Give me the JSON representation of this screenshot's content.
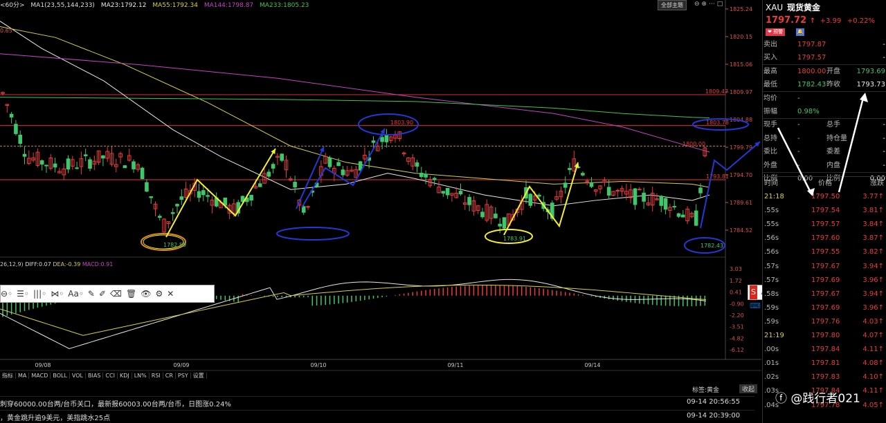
{
  "topbar": {
    "period": "<60分>",
    "ma1": "MA1(23,55,144,233)",
    "ma23": "MA23:1792.12",
    "ma55": "MA55:1792.34",
    "ma144": "MA144:1798.87",
    "ma233": "MA233:1805.23",
    "theme_btn": "全部主题",
    "left_edge_value": "0.65"
  },
  "price_axis": [
    "1825.24",
    "1820.15",
    "1815.06",
    "1809.97",
    "1804.88",
    "1799.79",
    "1794.70",
    "1789.61",
    "1784.52"
  ],
  "macd_axis": [
    "3.03",
    "1.72",
    "0.41",
    "-0.90",
    "-2.20",
    "-3.51",
    "-4.82",
    "-6.12"
  ],
  "macd_header": {
    "params": "26,12,9)",
    "diff": "DIFF:0.07",
    "dea": "DEA:-0.39",
    "macd": "MACD:0.91"
  },
  "date_axis": [
    "09/08",
    "09/09",
    "09/10",
    "09/11",
    "09/14"
  ],
  "annotations": {
    "low1": "1782.59",
    "high1": "1803.90",
    "low2": "1783.91",
    "low3": "1782.43",
    "hl1": "1809.47",
    "hl2": "1803.78",
    "hl3": "1800.00",
    "hl4": "1793.81"
  },
  "drawing_toolbar": {
    "items": [
      "⊖◦",
      "☰◦",
      "|||◦",
      "⋈◦",
      "Aa◦",
      "✎",
      "✐",
      "⌫",
      "🗑",
      "👁",
      "⚙",
      "✕"
    ]
  },
  "indicator_tabs": [
    "指标",
    "MA",
    "MACD",
    "BOLL",
    "VOL",
    "BIAS",
    "CCI",
    "KDJ",
    "LN%",
    "RSI",
    "CR",
    "PSY",
    "设置"
  ],
  "bottom": {
    "tag": "标签:黄金",
    "collapse": "收起",
    "news": [
      {
        "text": "刺穿60000.00台两/台币关口，最新报60003.00台两/台币，日图涨0.24%",
        "time": "09-14 20:56:55"
      },
      {
        "text": "，黄金跳升逾9美元，美指跳水25点",
        "time": "09-14 20:39:00"
      }
    ]
  },
  "watermark": "@践行者021",
  "panel": {
    "code": "XAU",
    "name": "现货黄金",
    "price": "1797.72",
    "change": "+3.99",
    "change_pct": "+0.22%",
    "btn_alert": "预警",
    "stats": [
      {
        "l": "卖出",
        "v": "1797.87",
        "l2": "",
        "v2": "-"
      },
      {
        "l": "买入",
        "v": "1797.57",
        "l2": "",
        "v2": "-"
      },
      {
        "l": "最高",
        "v": "1800.00",
        "l2": "开盘",
        "v2": "1793.69"
      },
      {
        "l": "最低",
        "v": "1782.43",
        "l2": "昨收",
        "v2": "1793.73"
      },
      {
        "l": "均价",
        "v": "-",
        "l2": "",
        "v2": ""
      },
      {
        "l": "振幅",
        "v": "0.98%",
        "l2": "",
        "v2": ""
      },
      {
        "l": "现手",
        "v": "-",
        "l2": "总手",
        "v2": "-"
      },
      {
        "l": "总持",
        "v": "-",
        "l2": "持仓量",
        "v2": "-"
      },
      {
        "l": "委比",
        "v": "-",
        "l2": "委差",
        "v2": "-"
      },
      {
        "l": "外盘",
        "v": "-",
        "l2": "内盘",
        "v2": "-"
      },
      {
        "l": "比例",
        "v": "0.00",
        "l2": "比例",
        "v2": "0.00"
      }
    ],
    "ticks_header": [
      "时间",
      "价格",
      "涨跌"
    ],
    "ticks": [
      {
        "t": "21:18",
        "p": "1797.50",
        "c": "3.77"
      },
      {
        "t": ".55s",
        "p": "1797.54",
        "c": "3.81"
      },
      {
        "t": ".55s",
        "p": "1797.57",
        "c": "3.84"
      },
      {
        "t": ".56s",
        "p": "1797.60",
        "c": "3.87"
      },
      {
        "t": ".56s",
        "p": "1797.55",
        "c": "3.82"
      },
      {
        "t": ".57s",
        "p": "1797.67",
        "c": "3.94"
      },
      {
        "t": ".57s",
        "p": "1797.69",
        "c": "3.96"
      },
      {
        "t": ".58s",
        "p": "1797.67",
        "c": "3.94"
      },
      {
        "t": ".59s",
        "p": "1797.69",
        "c": "3.96"
      },
      {
        "t": ".59s",
        "p": "1797.76",
        "c": "4.03"
      },
      {
        "t": "21:19",
        "p": "1797.80",
        "c": "4.07"
      },
      {
        "t": ".00s",
        "p": "1797.84",
        "c": "4.11"
      },
      {
        "t": ".01s",
        "p": "1797.81",
        "c": "4.08"
      },
      {
        "t": ".02s",
        "p": "1797.83",
        "c": "4.10"
      },
      {
        "t": ".03s",
        "p": "1797.84",
        "c": "4.11"
      },
      {
        "t": ".04s",
        "p": "1797.78",
        "c": "4.05"
      }
    ]
  },
  "colors": {
    "up": "#ef3a3a",
    "down": "#3fc76b",
    "ma23": "#e8e8e8",
    "ma55": "#d7d23a",
    "ma144": "#c742c7",
    "ma233": "#3fc84a",
    "blue": "#2438d8",
    "yellow": "#f4f02a"
  }
}
